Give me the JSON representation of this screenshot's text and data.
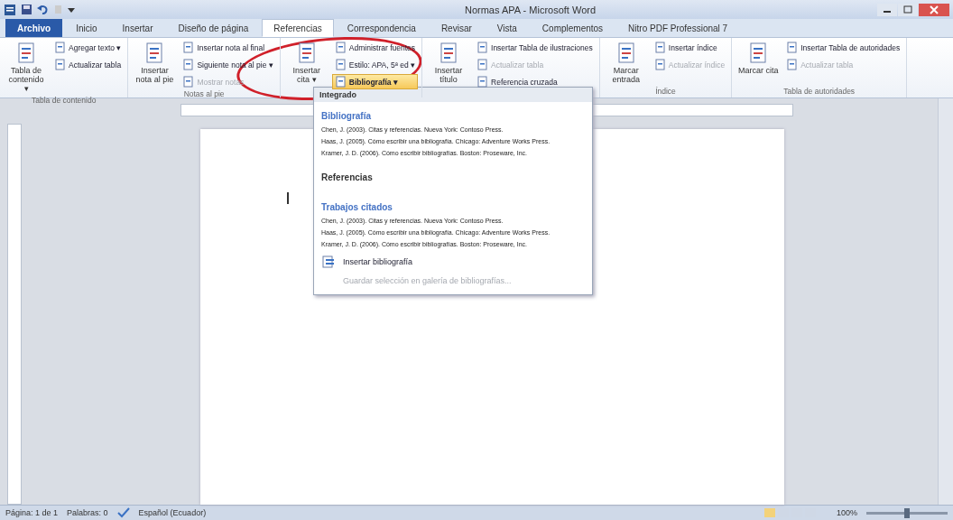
{
  "window": {
    "title": "Normas APA - Microsoft Word"
  },
  "tabs": [
    {
      "label": "Archivo",
      "kind": "file",
      "selected": false
    },
    {
      "label": "Inicio",
      "kind": "tab",
      "selected": false
    },
    {
      "label": "Insertar",
      "kind": "tab",
      "selected": false
    },
    {
      "label": "Diseño de página",
      "kind": "tab",
      "selected": false
    },
    {
      "label": "Referencias",
      "kind": "tab",
      "selected": true
    },
    {
      "label": "Correspondencia",
      "kind": "tab",
      "selected": false
    },
    {
      "label": "Revisar",
      "kind": "tab",
      "selected": false
    },
    {
      "label": "Vista",
      "kind": "tab",
      "selected": false
    },
    {
      "label": "Complementos",
      "kind": "tab",
      "selected": false
    },
    {
      "label": "Nitro PDF Professional 7",
      "kind": "tab",
      "selected": false
    }
  ],
  "ribbon": {
    "groups": [
      {
        "label": "Tabla de contenido",
        "large": {
          "label": "Tabla de contenido ▾"
        },
        "small": [
          {
            "label": "Agregar texto ▾",
            "disabled": false,
            "open": false
          },
          {
            "label": "Actualizar tabla",
            "disabled": false,
            "open": false
          }
        ]
      },
      {
        "label": "Notas al pie",
        "large": {
          "label": "Insertar nota al pie"
        },
        "small": [
          {
            "label": "Insertar nota al final",
            "disabled": false,
            "open": false
          },
          {
            "label": "Siguiente nota al pie ▾",
            "disabled": false,
            "open": false
          },
          {
            "label": "Mostrar notas",
            "disabled": true,
            "open": false
          }
        ]
      },
      {
        "large": {
          "label": "Insertar cita ▾"
        },
        "small": [
          {
            "label": "Administrar fuentes",
            "disabled": false,
            "open": false
          },
          {
            "label": "Estilo: APA, 5ª ed ▾",
            "disabled": false,
            "open": false
          },
          {
            "label": "Bibliografía ▾",
            "disabled": false,
            "open": true
          }
        ]
      },
      {
        "large": {
          "label": "Insertar título"
        },
        "small": [
          {
            "label": "Insertar Tabla de ilustraciones",
            "disabled": false,
            "open": false
          },
          {
            "label": "Actualizar tabla",
            "disabled": true,
            "open": false
          },
          {
            "label": "Referencia cruzada",
            "disabled": false,
            "open": false
          }
        ]
      },
      {
        "label": "Índice",
        "large": {
          "label": "Marcar entrada"
        },
        "small": [
          {
            "label": "Insertar índice",
            "disabled": false,
            "open": false
          },
          {
            "label": "Actualizar índice",
            "disabled": true,
            "open": false
          }
        ]
      },
      {
        "label": "Tabla de autoridades",
        "large": {
          "label": "Marcar cita"
        },
        "small": [
          {
            "label": "Insertar Tabla de autoridades",
            "disabled": false,
            "open": false
          },
          {
            "label": "Actualizar tabla",
            "disabled": true,
            "open": false
          }
        ]
      }
    ]
  },
  "bibliography_menu": {
    "header": "Integrado",
    "items": [
      {
        "title": "Bibliografía",
        "entries": [
          "Chen, J. (2003). Citas y referencias. Nueva York: Contoso Press.",
          "Haas, J. (2005). Cómo escribir una bibliografía. Chicago: Adventure Works Press.",
          "Kramer, J. D. (2006). Cómo escribir bibliografías. Boston: Proseware, Inc."
        ]
      },
      {
        "title": "Referencias"
      },
      {
        "title": "Trabajos citados",
        "entries": [
          "Chen, J. (2003). Citas y referencias. Nueva York: Contoso Press.",
          "Haas, J. (2005). Cómo escribir una bibliografía. Chicago: Adventure Works Press.",
          "Kramer, J. D. (2006). Cómo escribir bibliografías. Boston: Proseware, Inc."
        ]
      }
    ],
    "actions": [
      {
        "label": "Insertar bibliografía",
        "disabled": false
      },
      {
        "label": "Guardar selección en galería de bibliografías...",
        "disabled": true
      }
    ]
  },
  "status_bar": {
    "page": "Página: 1 de 1",
    "words": "Palabras: 0",
    "language": "Español (Ecuador)",
    "zoom": "100%",
    "zoom_slider": {
      "level": 0.5
    }
  }
}
